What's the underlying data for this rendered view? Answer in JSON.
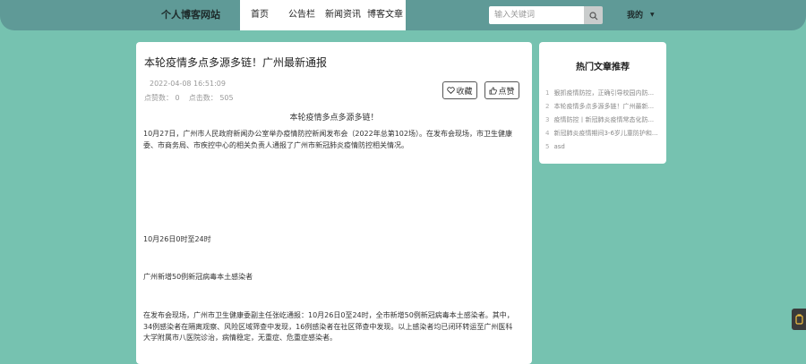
{
  "navbar": {
    "brand": "个人博客网站",
    "items": [
      {
        "label": "首页"
      },
      {
        "label": "公告栏"
      },
      {
        "label": "新闻资讯"
      },
      {
        "label": "博客文章"
      }
    ],
    "search": {
      "placeholder": "输入关键词",
      "icon": "search-icon"
    },
    "user": {
      "label": "我的",
      "icon": "caret-down-icon"
    }
  },
  "article": {
    "title": "本轮疫情多点多源多链！广州最新通报",
    "date": "2022-04-08 16:51:09",
    "counts": "点赞数： 0    点击数： 505",
    "favorite_label": "收藏",
    "favorite_icon": "heart-icon",
    "like_label": "点赞",
    "like_icon": "thumbs-up-icon",
    "subheading": "本轮疫情多点多源多链！",
    "paragraphs": [
      "10月27日，广州市人民政府新闻办公室举办疫情防控新闻发布会（2022年总第102场）。在发布会现场，市卫生健康委、市商务局、市疾控中心的相关负责人通报了广州市新冠肺炎疫情防控相关情况。",
      "10月26日0时至24时",
      "广州新增50例新冠病毒本土感染者",
      "在发布会现场，广州市卫生健康委副主任张屹通报：10月26日0至24时，全市新增50例新冠病毒本土感染者。其中，34例感染者在隔离观察、风险区域筛查中发现，16例感染者在社区筛查中发现。以上感染者均已闭环转运至广州医科大学附属市八医院诊治，病情稳定，无重症、危重症感染者。"
    ]
  },
  "sidebar": {
    "title": "热门文章推荐",
    "items": [
      {
        "num": "1",
        "label": "狠抓疫情防控，正确引导校园内防..."
      },
      {
        "num": "2",
        "label": "本轮疫情多点多源多链！广州最新..."
      },
      {
        "num": "3",
        "label": "疫情防控丨新冠肺炎疫情常态化防..."
      },
      {
        "num": "4",
        "label": "新冠肺炎疫情期间3-6岁儿童防护和..."
      },
      {
        "num": "5",
        "label": "asd"
      }
    ]
  },
  "widget": {
    "icon": "cup-icon"
  },
  "colors": {
    "page_bg": "#76c2b0",
    "navbar_bg": "#5f9a97",
    "card_bg": "#ffffff"
  }
}
